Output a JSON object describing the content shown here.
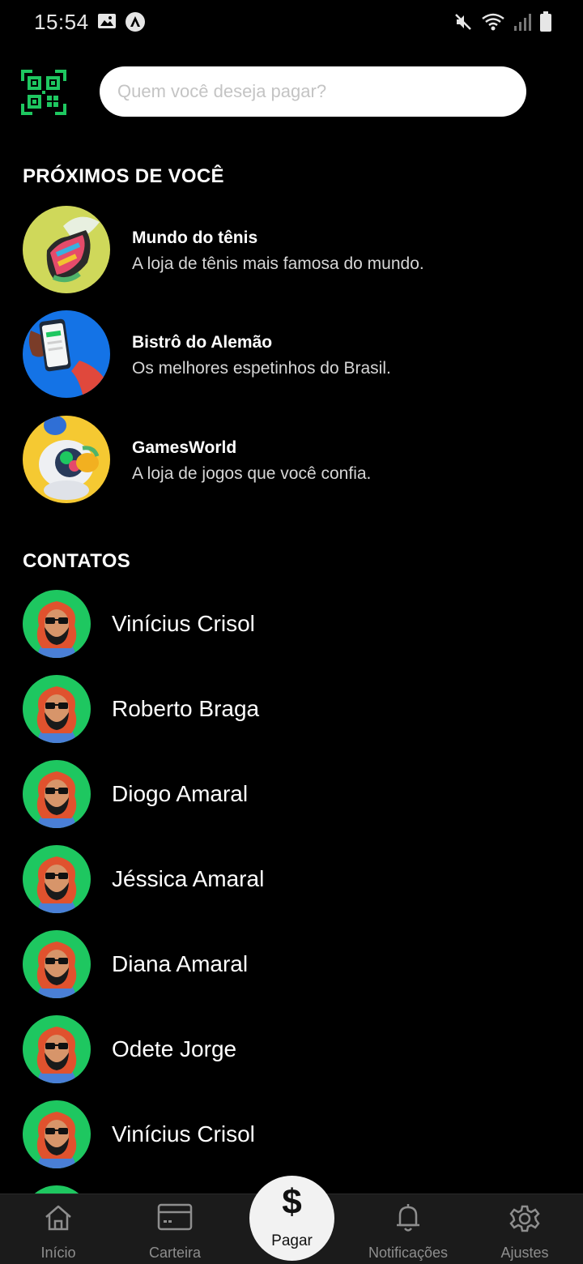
{
  "status_bar": {
    "time": "15:54"
  },
  "search": {
    "placeholder": "Quem você deseja pagar?"
  },
  "nearby": {
    "title": "PRÓXIMOS DE VOCÊ",
    "stores": [
      {
        "name": "Mundo do tênis",
        "description": "A loja de tênis mais famosa do mundo."
      },
      {
        "name": "Bistrô do Alemão",
        "description": "Os melhores espetinhos do Brasil."
      },
      {
        "name": "GamesWorld",
        "description": "A loja de jogos que você confia."
      }
    ]
  },
  "contacts": {
    "title": "CONTATOS",
    "items": [
      {
        "name": "Vinícius Crisol"
      },
      {
        "name": "Roberto Braga"
      },
      {
        "name": "Diogo Amaral"
      },
      {
        "name": "Jéssica Amaral"
      },
      {
        "name": "Diana Amaral"
      },
      {
        "name": "Odete Jorge"
      },
      {
        "name": "Vinícius Crisol"
      }
    ]
  },
  "bottom_nav": {
    "items": [
      {
        "label": "Início",
        "icon": "home-icon"
      },
      {
        "label": "Carteira",
        "icon": "wallet-card-icon"
      },
      {
        "label": "Notificações",
        "icon": "bell-icon"
      },
      {
        "label": "Ajustes",
        "icon": "gear-icon"
      }
    ],
    "pay": {
      "symbol": "$",
      "label": "Pagar"
    }
  },
  "colors": {
    "accent": "#1ec760",
    "background": "#000000",
    "nav_background": "#1b1b1b"
  }
}
